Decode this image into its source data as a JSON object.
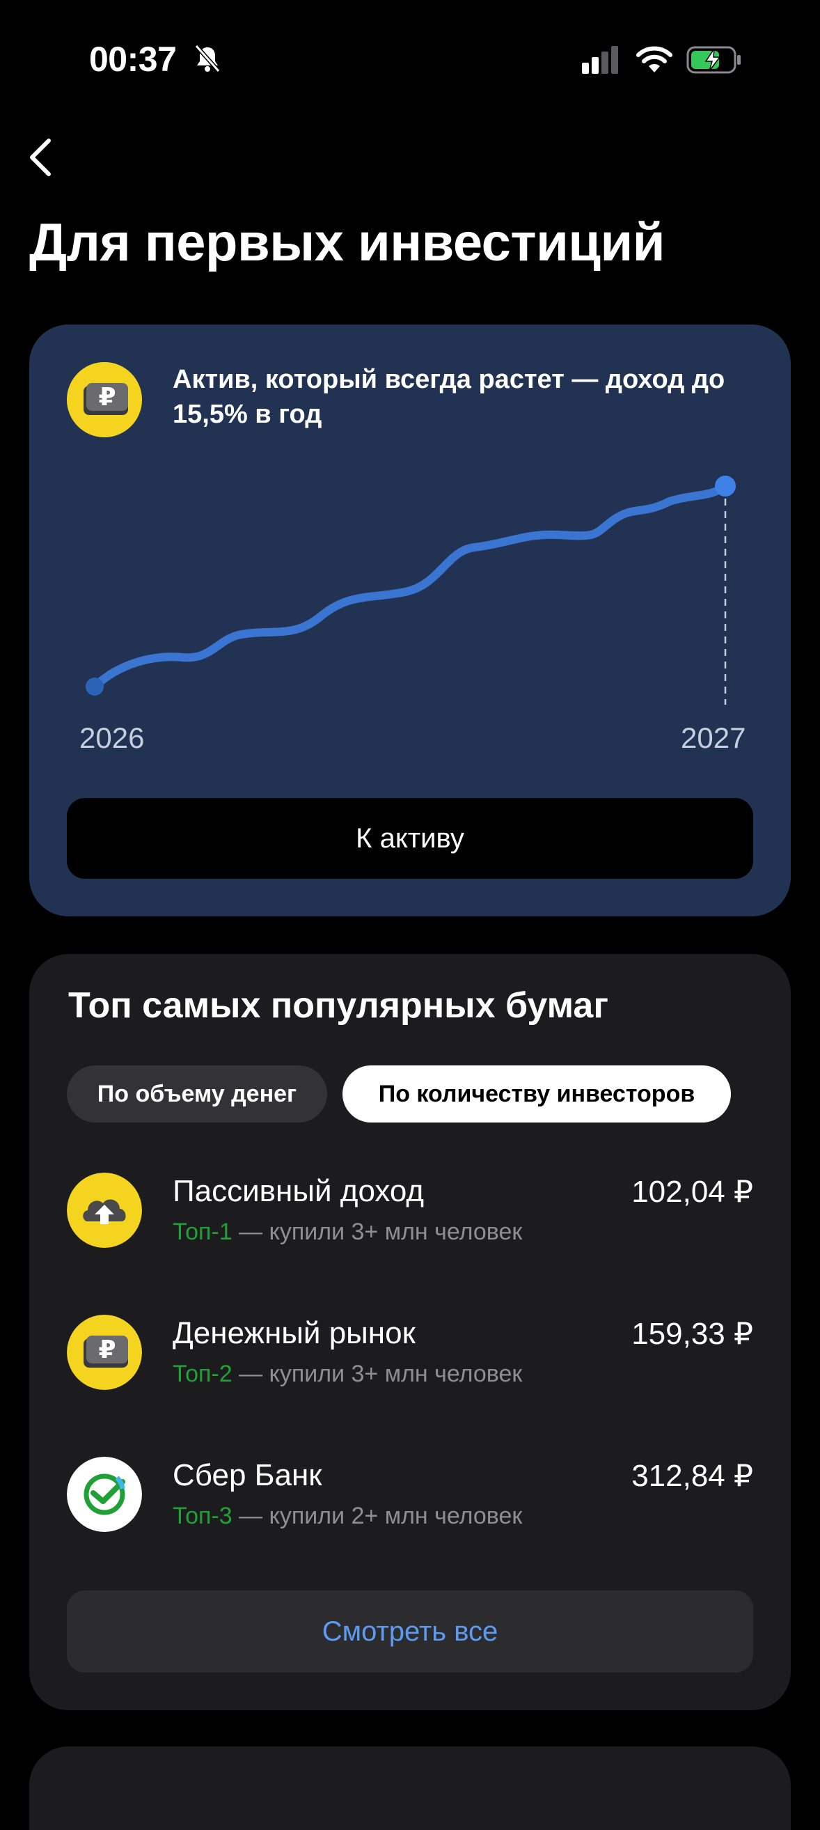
{
  "status": {
    "time": "00:37"
  },
  "page": {
    "title": "Для первых инвестиций"
  },
  "promo": {
    "headline": "Актив, который всегда растет — доход до 15,5% в год",
    "year_start": "2026",
    "year_end": "2027",
    "button_label": "К активу"
  },
  "top": {
    "title": "Топ самых популярных бумаг",
    "tabs": [
      {
        "label": "По объему денег",
        "selected": false
      },
      {
        "label": "По количеству инвесторов",
        "selected": true
      }
    ],
    "items": [
      {
        "name": "Пассивный доход",
        "rank": "Топ-1",
        "detail": " — купили 3+ млн человек",
        "price": "102,04 ₽",
        "icon": "passive-income-icon"
      },
      {
        "name": "Денежный рынок",
        "rank": "Топ-2",
        "detail": " — купили 3+ млн человек",
        "price": "159,33 ₽",
        "icon": "money-market-icon"
      },
      {
        "name": "Сбер Банк",
        "rank": "Топ-3",
        "detail": " — купили 2+ млн человек",
        "price": "312,84 ₽",
        "icon": "sber-logo-icon"
      }
    ],
    "see_all_label": "Смотреть все"
  },
  "colors": {
    "card": "#213252",
    "accent": "#3e82e8",
    "rank": "#21a038",
    "link": "#5b9bf2"
  }
}
